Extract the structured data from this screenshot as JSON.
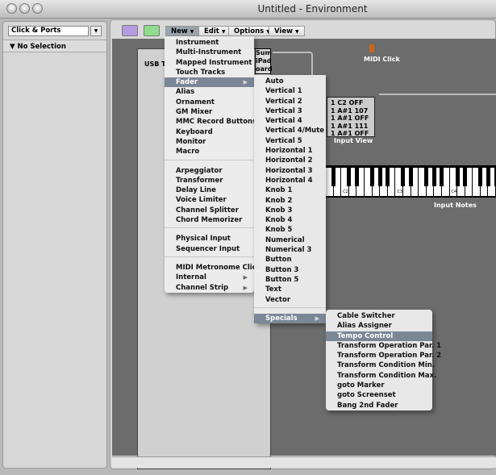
{
  "window": {
    "title": "Untitled - Environment"
  },
  "left_panel": {
    "layer_select": "Click & Ports",
    "section": "No Selection"
  },
  "toolbar": {
    "menus": [
      "New",
      "Edit",
      "Options",
      "View"
    ],
    "icons": [
      "link-icon",
      "midi-out-icon"
    ]
  },
  "canvas": {
    "object_label": "USB Tr",
    "port_labels": [
      "Sum",
      "iPad",
      "oard"
    ],
    "midi_click": "MIDI Click",
    "input_view": {
      "label": "Input View",
      "rows": [
        "1  C2   OFF",
        "1 A#1  107",
        "1 A#1  OFF",
        "1 A#1  111",
        "1 A#1  OFF"
      ]
    },
    "keyboard": {
      "label": "Input Notes",
      "octave_labels": [
        "C2",
        "C3",
        "C4"
      ]
    }
  },
  "new_menu": {
    "items": [
      [
        "Instrument",
        "Multi-Instrument",
        "Mapped Instrument",
        "Touch Tracks",
        "Fader",
        "Alias",
        "Ornament",
        "GM Mixer",
        "MMC Record Buttons",
        "Keyboard",
        "Monitor",
        "Macro"
      ],
      [
        "Arpeggiator",
        "Transformer",
        "Delay Line",
        "Voice Limiter",
        "Channel Splitter",
        "Chord Memorizer"
      ],
      [
        "Physical Input",
        "Sequencer Input"
      ],
      [
        "MIDI Metronome Click",
        "Internal",
        "Channel Strip"
      ]
    ],
    "highlighted": "Fader",
    "submenu_items": [
      "Fader",
      "Internal",
      "Channel Strip"
    ]
  },
  "fader_menu": {
    "items": [
      [
        "Auto",
        "Vertical 1",
        "Vertical 2",
        "Vertical 3",
        "Vertical 4",
        "Vertical 4/Mute",
        "Vertical 5",
        "Horizontal 1",
        "Horizontal 2",
        "Horizontal 3",
        "Horizontal 4",
        "Knob 1",
        "Knob 2",
        "Knob 3",
        "Knob 4",
        "Knob 5",
        "Numerical",
        "Numerical 3",
        "Button",
        "Button 3",
        "Button 5",
        "Text",
        "Vector"
      ],
      [
        "Specials"
      ]
    ],
    "highlighted": "Specials",
    "submenu_items": [
      "Specials"
    ]
  },
  "specials_menu": {
    "items": [
      [
        "Cable Switcher",
        "Alias Assigner",
        "Tempo Control",
        "Transform Operation Par. 1",
        "Transform Operation Par. 2",
        "Transform Condition Min.",
        "Transform Condition Max.",
        "goto Marker",
        "goto Screenset",
        "Bang 2nd Fader"
      ]
    ],
    "highlighted": "Tempo Control",
    "submenu_items": []
  },
  "colors": {
    "highlight": "#7b8797",
    "canvas": "#6c6c6c"
  }
}
